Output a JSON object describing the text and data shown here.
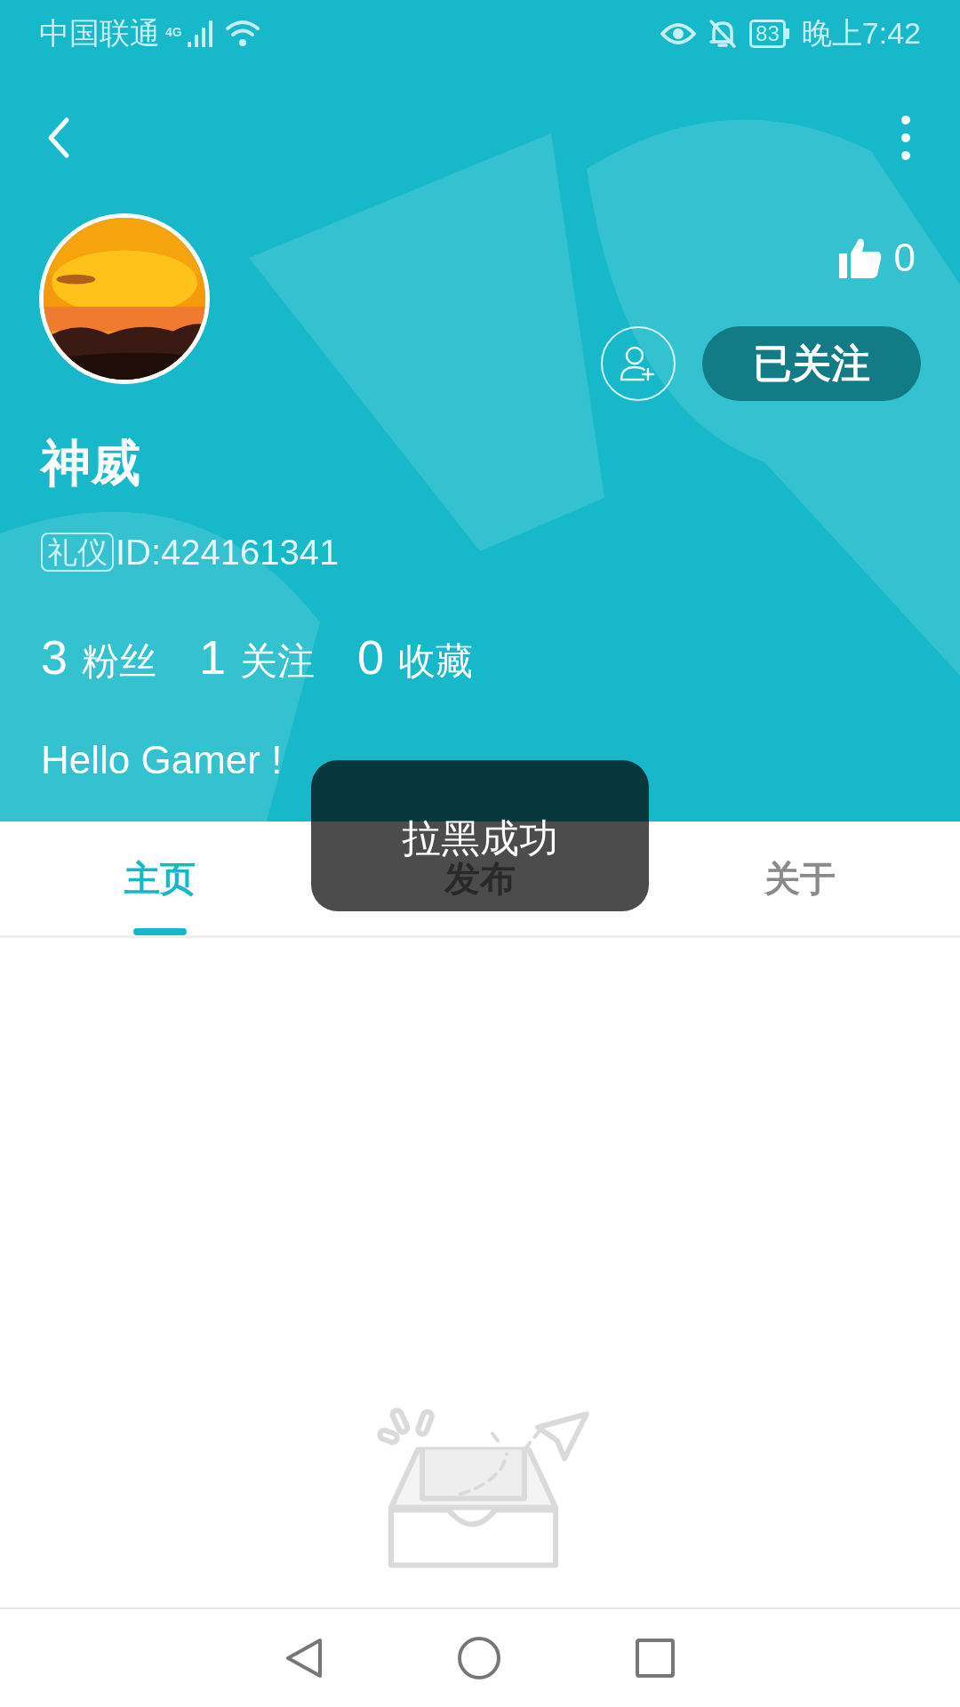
{
  "status_bar": {
    "carrier": "中国联通",
    "network": "4G",
    "battery": "83",
    "time": "晚上7:42"
  },
  "profile": {
    "likes": "0",
    "follow_button": "已关注",
    "followed": true,
    "name": "神威",
    "tag": "礼仪",
    "user_id": "ID:424161341",
    "stats": [
      {
        "count": "3",
        "name": "粉丝"
      },
      {
        "count": "1",
        "name": "关注"
      },
      {
        "count": "0",
        "name": "收藏"
      }
    ],
    "bio": "Hello Gamer !"
  },
  "tabs": [
    {
      "label": "主页",
      "selected": true
    },
    {
      "label": "发布",
      "selected": false
    },
    {
      "label": "关于",
      "selected": false
    }
  ],
  "toast": "拉黑成功"
}
